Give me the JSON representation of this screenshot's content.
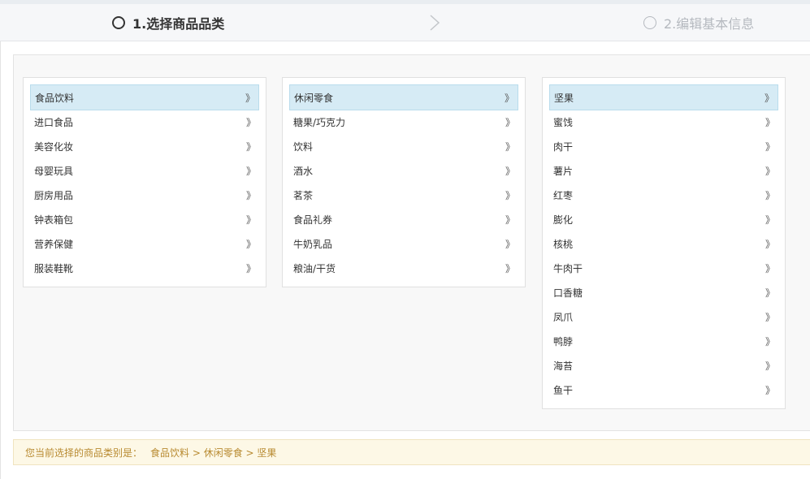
{
  "steps": {
    "step1": "1.选择商品品类",
    "step2": "2.编辑基本信息"
  },
  "arrow_glyph": "》",
  "columns": {
    "col1": [
      "食品饮料",
      "进口食品",
      "美容化妆",
      "母婴玩具",
      "厨房用品",
      "钟表箱包",
      "营养保健",
      "服装鞋靴"
    ],
    "col2": [
      "休闲零食",
      "糖果/巧克力",
      "饮料",
      "酒水",
      "茗茶",
      "食品礼券",
      "牛奶乳品",
      "粮油/干货"
    ],
    "col3": [
      "坚果",
      "蜜饯",
      "肉干",
      "薯片",
      "红枣",
      "膨化",
      "核桃",
      "牛肉干",
      "口香糖",
      "凤爪",
      "鸭脖",
      "海苔",
      "鱼干"
    ]
  },
  "selected": {
    "col1": 0,
    "col2": 0,
    "col3": 0
  },
  "selection_bar": {
    "label": "您当前选择的商品类别是：",
    "path": "食品饮料 > 休闲零食 > 坚果"
  },
  "colors": {
    "accent_bg": "#d6ebf5",
    "bar_text": "#b88a30",
    "bar_bg": "#fdf8e6"
  }
}
